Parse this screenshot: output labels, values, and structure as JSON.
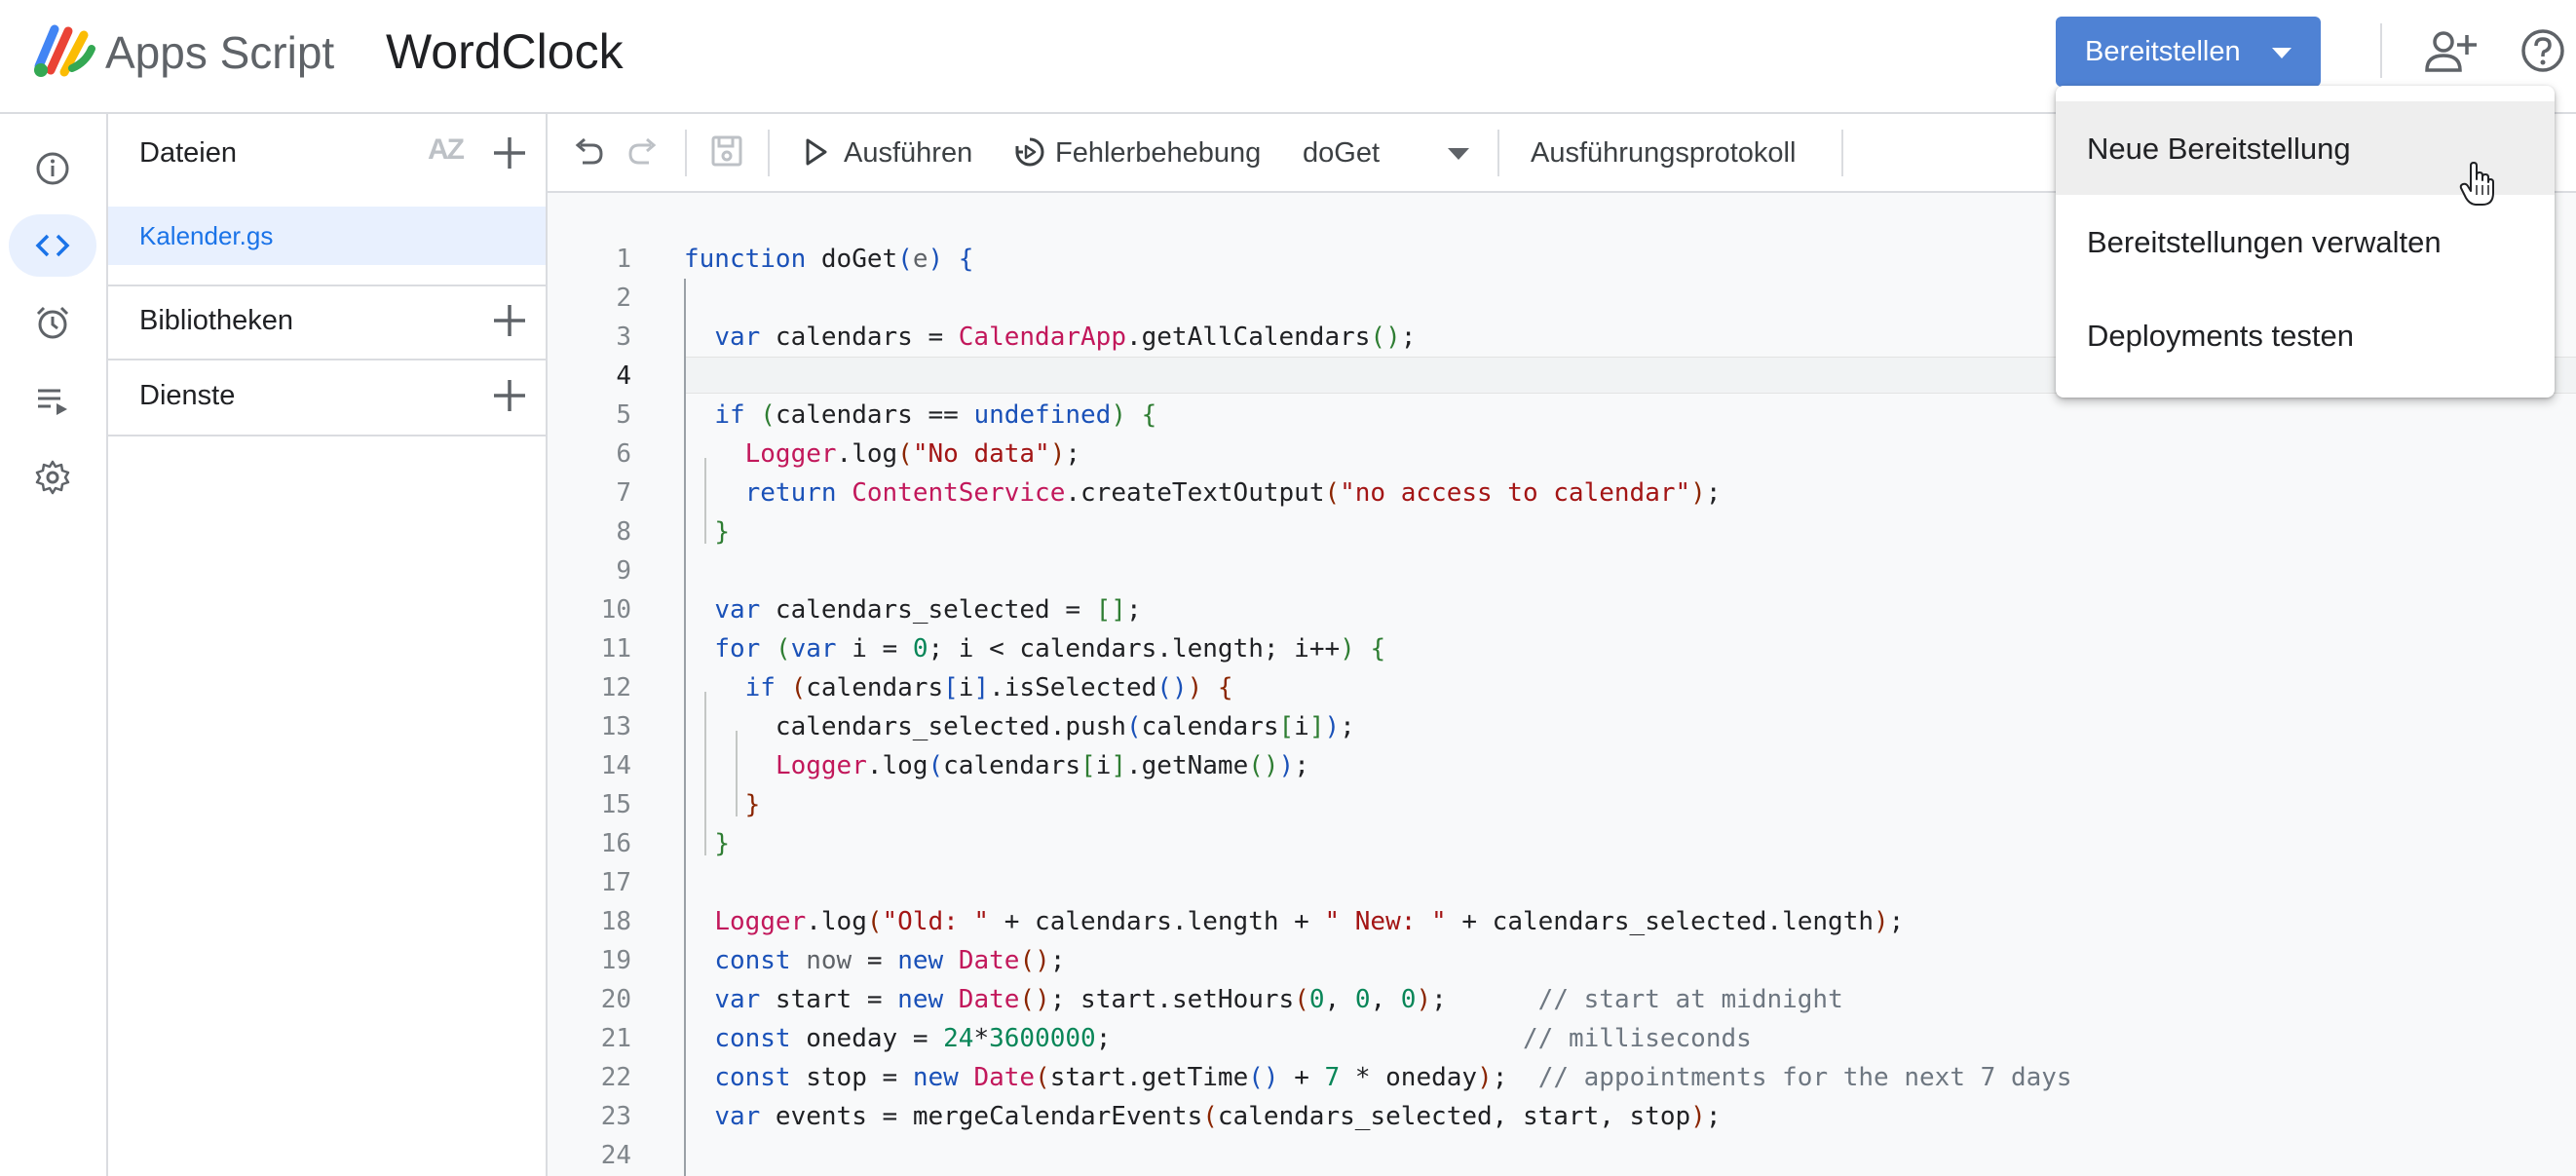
{
  "header": {
    "app_name": "Apps Script",
    "project_title": "WordClock",
    "deploy_label": "Bereitstellen",
    "accent": "#4f82d4"
  },
  "rail": {
    "items": [
      {
        "icon": "info-icon"
      },
      {
        "icon": "code-icon",
        "active": true
      },
      {
        "icon": "alarm-icon"
      },
      {
        "icon": "executions-icon"
      },
      {
        "icon": "gear-icon"
      }
    ]
  },
  "files": {
    "title": "Dateien",
    "sort_label": "AZ",
    "items": [
      {
        "name": "Kalender.gs"
      }
    ],
    "libraries_label": "Bibliotheken",
    "services_label": "Dienste"
  },
  "toolbar": {
    "run_label": "Ausführen",
    "debug_label": "Fehlerbehebung",
    "function_selected": "doGet",
    "log_label": "Ausführungsprotokoll"
  },
  "editor": {
    "line_numbers": [
      "1",
      "2",
      "3",
      "4",
      "5",
      "6",
      "7",
      "8",
      "9",
      "10",
      "11",
      "12",
      "13",
      "14",
      "15",
      "16",
      "17",
      "18",
      "19",
      "20",
      "21",
      "22",
      "23",
      "24"
    ]
  },
  "deploy_menu": {
    "items": [
      {
        "label": "Neue Bereitstellung"
      },
      {
        "label": "Bereitstellungen verwalten"
      },
      {
        "label": "Deployments testen"
      }
    ]
  }
}
